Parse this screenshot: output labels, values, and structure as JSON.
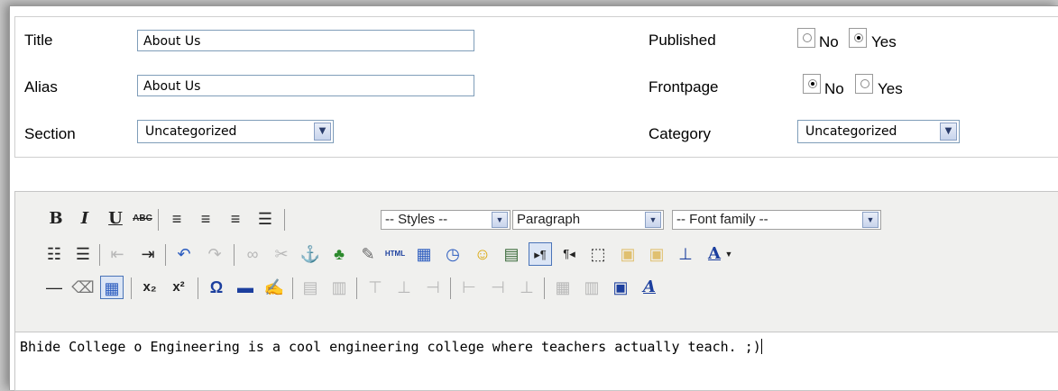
{
  "form": {
    "title_label": "Title",
    "title_value": "About Us",
    "alias_label": "Alias",
    "alias_value": "About Us",
    "section_label": "Section",
    "section_value": "Uncategorized",
    "published_label": "Published",
    "published_options": [
      "No",
      "Yes"
    ],
    "published_selected": "Yes",
    "frontpage_label": "Frontpage",
    "frontpage_options": [
      "No",
      "Yes"
    ],
    "frontpage_selected": "No",
    "category_label": "Category",
    "category_value": "Uncategorized"
  },
  "toolbar": {
    "styles": "-- Styles --",
    "format": "Paragraph",
    "font_family": "-- Font family --",
    "bold": "B",
    "italic": "I",
    "underline": "U",
    "strike": "ABC",
    "html": "HTML"
  },
  "editor": {
    "content": "Bhide College o Engineering is a cool engineering college where teachers actually teach. ;)"
  },
  "colors": {
    "field_border": "#7f9db9",
    "toolbar_bg": "#f0f0ee",
    "active_button": "#dbe5f5"
  }
}
